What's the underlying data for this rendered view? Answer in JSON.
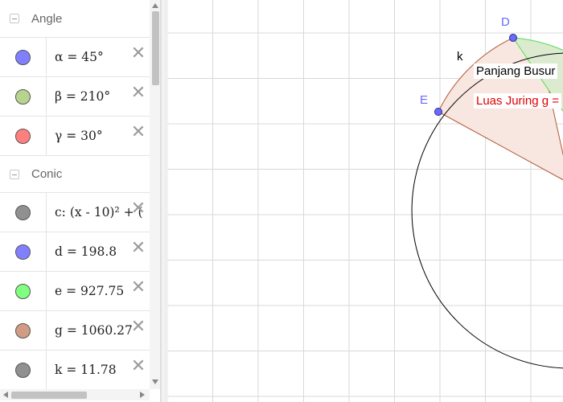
{
  "algebra": {
    "groups": [
      {
        "title": "Angle",
        "items": [
          {
            "text": "α = 45°",
            "color": "#8080ff"
          },
          {
            "text": "β = 210°",
            "color": "#b7d48f"
          },
          {
            "text": "γ = 30°",
            "color": "#ff7f7f"
          }
        ]
      },
      {
        "title": "Conic",
        "items": [
          {
            "text": "c: (x - 10)² + (",
            "color": "#909090"
          },
          {
            "text": "d = 198.8",
            "color": "#8080ff"
          },
          {
            "text": "e = 927.75",
            "color": "#80ff80"
          },
          {
            "text": "g = 1060.27",
            "color": "#d09c84"
          },
          {
            "text": "k = 11.78",
            "color": "#909090"
          }
        ]
      }
    ],
    "close_glyph": "✕"
  },
  "graphics": {
    "point_labels": {
      "D": "D",
      "E": "E",
      "k": "k"
    },
    "textbox_1": "Panjang Busur",
    "textbox_2": "Luas Juring g =",
    "colors": {
      "grid": "#d8d8d8",
      "point": "#6a6aff",
      "sector_fill": "#f8e6e0",
      "sector_edge": "#b05a3a",
      "green_fill": "#dcebd0",
      "green_edge": "#4de04d",
      "label_red": "#e00000"
    }
  }
}
